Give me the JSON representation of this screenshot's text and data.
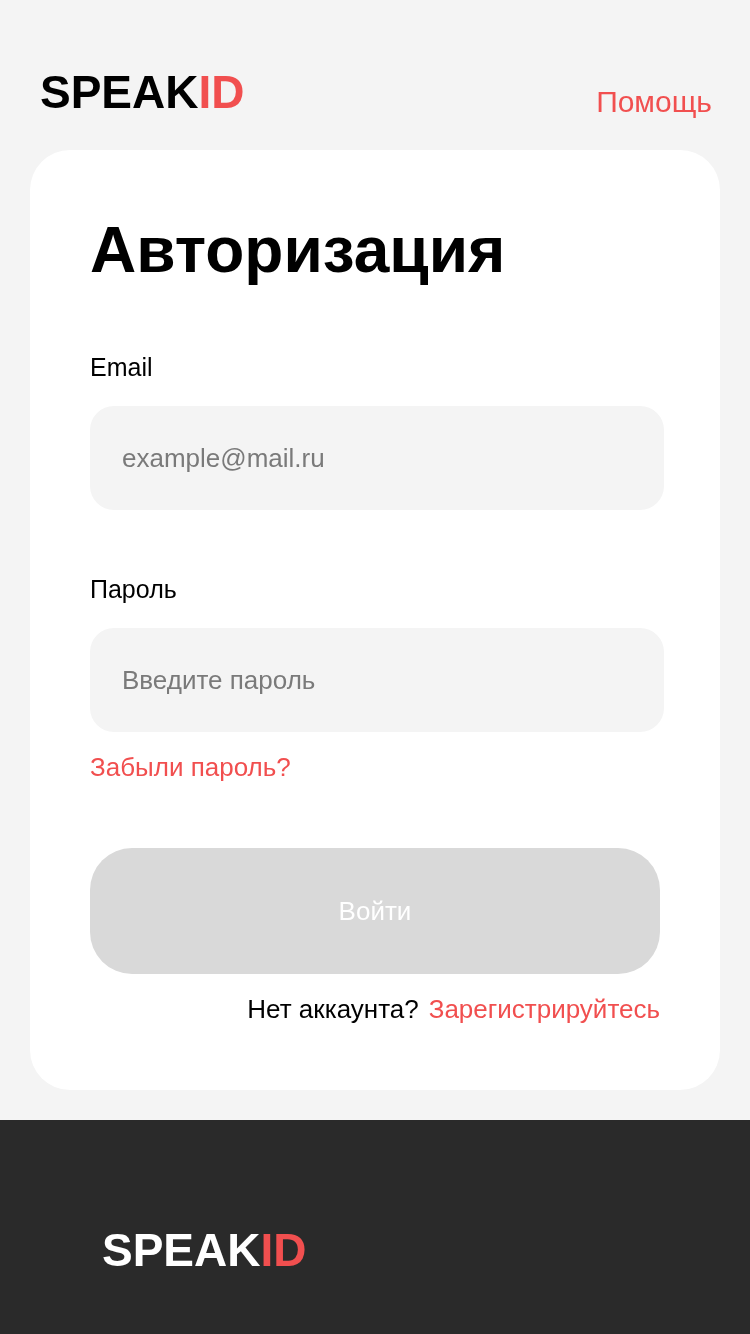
{
  "header": {
    "logo": {
      "main": "SPEAK",
      "accent": "ID"
    },
    "help_link": "Помощь"
  },
  "login_card": {
    "title": "Авторизация",
    "fields": [
      {
        "label": "Email",
        "placeholder": "example@mail.ru"
      },
      {
        "label": "Пароль",
        "placeholder": "Введите пароль"
      }
    ],
    "forgot_link": "Забыли пароль?",
    "submit_button": {
      "label": "Войти",
      "disabled": true
    },
    "signup_prompt": {
      "text": "Нет аккаунта?",
      "link": "Зарегистрируйтесь"
    }
  },
  "footer": {
    "logo": {
      "main": "SPEAK",
      "accent": "ID"
    }
  }
}
